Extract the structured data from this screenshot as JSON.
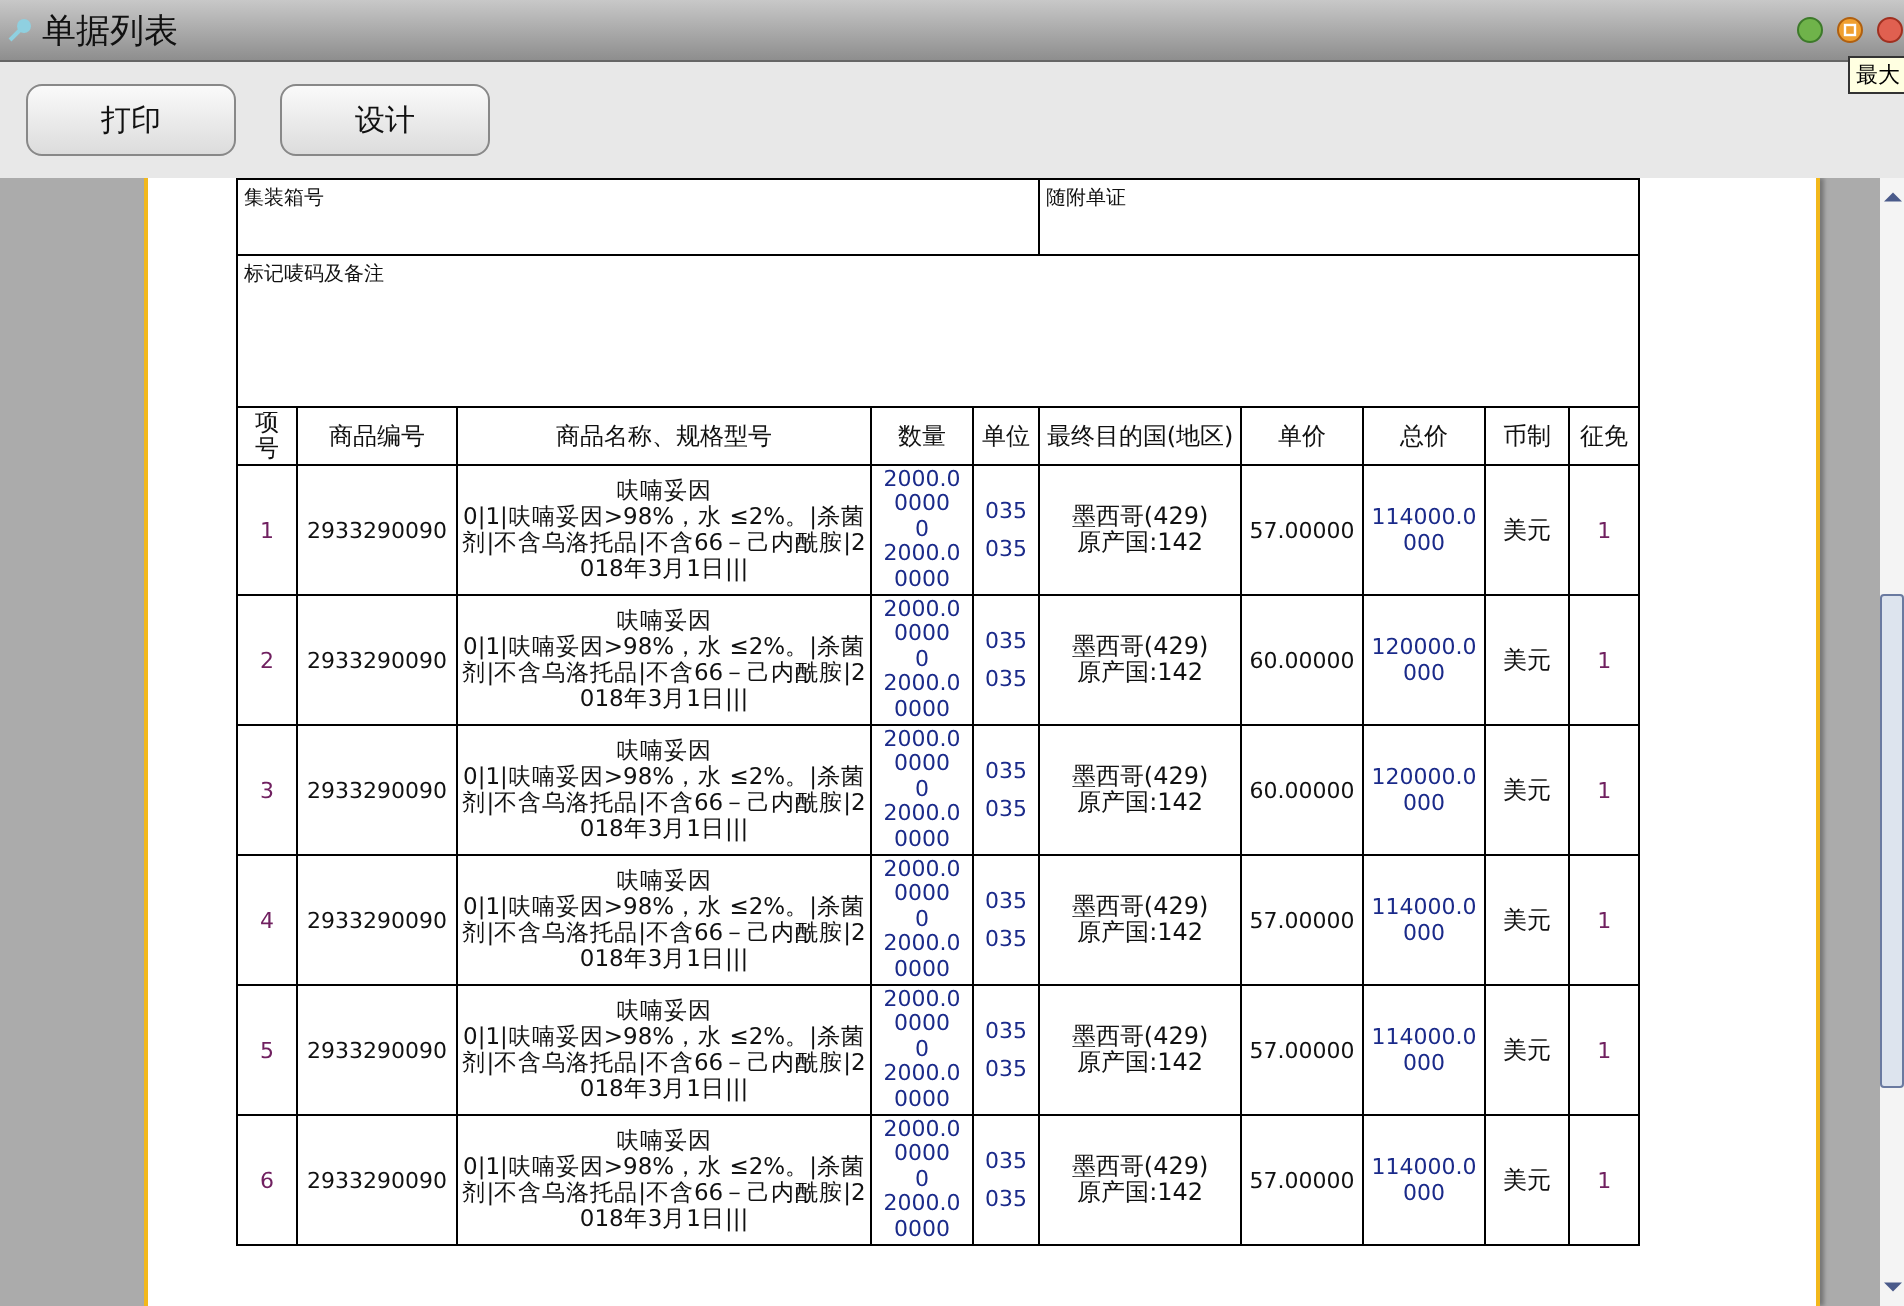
{
  "window": {
    "title": "单据列表",
    "tooltip": "最大"
  },
  "toolbar": {
    "buttons": [
      "打印",
      "设计"
    ]
  },
  "form": {
    "fields": [
      {
        "label": "集装箱号"
      },
      {
        "label": "随附单证"
      }
    ],
    "remarks_label": "标记唛码及备注"
  },
  "table": {
    "columns": [
      "项号",
      "商品编号",
      "商品名称、规格型号",
      "数量",
      "单位",
      "最终目的国(地区)",
      "单价",
      "总价",
      "币制",
      "征免"
    ],
    "rows": [
      {
        "item": "1",
        "code": "2933290090",
        "name": "呋喃妥因",
        "spec": "0|1|呋喃妥因>98%，水 ≤2%。|杀菌剂|不含乌洛托品|不含66－己内酰胺|2018年3月1日|||",
        "quantity": [
          "2000.00000",
          "0",
          "2000.00000"
        ],
        "units": [
          "035",
          "035"
        ],
        "country": [
          "墨西哥(429)",
          "原产国:142"
        ],
        "unit_price": "57.00000",
        "total": "114000.0000",
        "currency": "美元",
        "exemption": "1"
      },
      {
        "item": "2",
        "code": "2933290090",
        "name": "呋喃妥因",
        "spec": "0|1|呋喃妥因>98%，水 ≤2%。|杀菌剂|不含乌洛托品|不含66－己内酰胺|2018年3月1日|||",
        "quantity": [
          "2000.00000",
          "0",
          "2000.00000"
        ],
        "units": [
          "035",
          "035"
        ],
        "country": [
          "墨西哥(429)",
          "原产国:142"
        ],
        "unit_price": "60.00000",
        "total": "120000.0000",
        "currency": "美元",
        "exemption": "1"
      },
      {
        "item": "3",
        "code": "2933290090",
        "name": "呋喃妥因",
        "spec": "0|1|呋喃妥因>98%，水 ≤2%。|杀菌剂|不含乌洛托品|不含66－己内酰胺|2018年3月1日|||",
        "quantity": [
          "2000.00000",
          "0",
          "2000.00000"
        ],
        "units": [
          "035",
          "035"
        ],
        "country": [
          "墨西哥(429)",
          "原产国:142"
        ],
        "unit_price": "60.00000",
        "total": "120000.0000",
        "currency": "美元",
        "exemption": "1"
      },
      {
        "item": "4",
        "code": "2933290090",
        "name": "呋喃妥因",
        "spec": "0|1|呋喃妥因>98%，水 ≤2%。|杀菌剂|不含乌洛托品|不含66－己内酰胺|2018年3月1日|||",
        "quantity": [
          "2000.00000",
          "0",
          "2000.00000"
        ],
        "units": [
          "035",
          "035"
        ],
        "country": [
          "墨西哥(429)",
          "原产国:142"
        ],
        "unit_price": "57.00000",
        "total": "114000.0000",
        "currency": "美元",
        "exemption": "1"
      },
      {
        "item": "5",
        "code": "2933290090",
        "name": "呋喃妥因",
        "spec": "0|1|呋喃妥因>98%，水 ≤2%。|杀菌剂|不含乌洛托品|不含66－己内酰胺|2018年3月1日|||",
        "quantity": [
          "2000.00000",
          "0",
          "2000.00000"
        ],
        "units": [
          "035",
          "035"
        ],
        "country": [
          "墨西哥(429)",
          "原产国:142"
        ],
        "unit_price": "57.00000",
        "total": "114000.0000",
        "currency": "美元",
        "exemption": "1"
      },
      {
        "item": "6",
        "code": "2933290090",
        "name": "呋喃妥因",
        "spec": "0|1|呋喃妥因>98%，水 ≤2%。|杀菌剂|不含乌洛托品|不含66－己内酰胺|2018年3月1日|||",
        "quantity": [
          "2000.00000",
          "0",
          "2000.00000"
        ],
        "units": [
          "035",
          "035"
        ],
        "country": [
          "墨西哥(429)",
          "原产国:142"
        ],
        "unit_price": "57.00000",
        "total": "114000.0000",
        "currency": "美元",
        "exemption": "1"
      }
    ]
  }
}
